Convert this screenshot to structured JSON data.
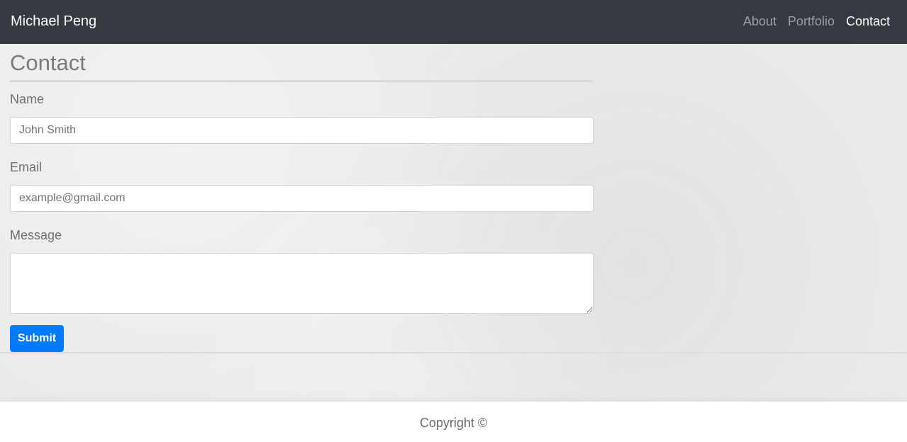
{
  "navbar": {
    "brand": "Michael Peng",
    "links": [
      {
        "label": "About",
        "active": false
      },
      {
        "label": "Portfolio",
        "active": false
      },
      {
        "label": "Contact",
        "active": true
      }
    ]
  },
  "main": {
    "title": "Contact",
    "form": {
      "name": {
        "label": "Name",
        "placeholder": "John Smith",
        "value": ""
      },
      "email": {
        "label": "Email",
        "placeholder": "example@gmail.com",
        "value": ""
      },
      "message": {
        "label": "Message",
        "placeholder": "",
        "value": ""
      },
      "submit_label": "Submit"
    }
  },
  "footer": {
    "text": "Copyright ©"
  },
  "colors": {
    "navbar_bg": "#343a40",
    "primary": "#007bff",
    "background": "#ebebeb"
  }
}
